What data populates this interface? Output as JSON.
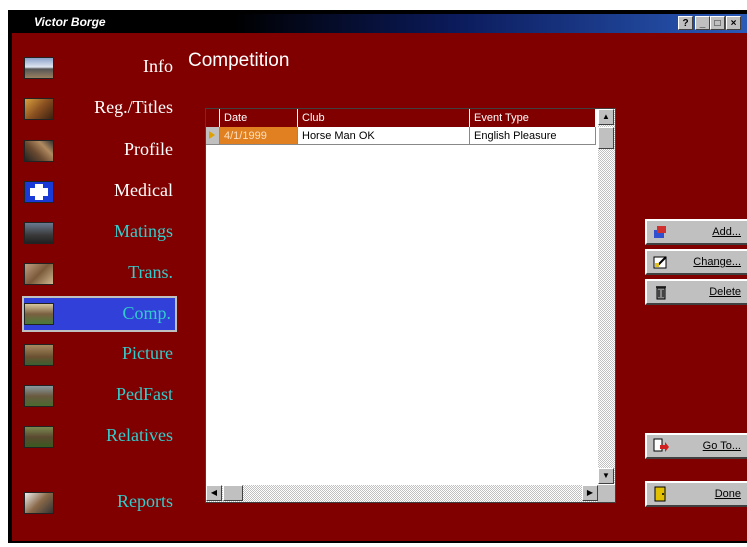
{
  "window": {
    "title": "Victor Borge",
    "controls": [
      "?",
      "_",
      "□",
      "×"
    ]
  },
  "nav": {
    "items": [
      {
        "label": "Info",
        "color": "#ffffff"
      },
      {
        "label": "Reg./Titles",
        "color": "#ffffff"
      },
      {
        "label": "Profile",
        "color": "#ffffff"
      },
      {
        "label": "Medical",
        "color": "#ffffff"
      },
      {
        "label": "Matings",
        "color": "#33cccc"
      },
      {
        "label": "Trans.",
        "color": "#33cccc"
      },
      {
        "label": "Comp.",
        "color": "#33cccc",
        "selected": true
      },
      {
        "label": "Picture",
        "color": "#33cccc"
      },
      {
        "label": "PedFast",
        "color": "#33cccc"
      },
      {
        "label": "Relatives",
        "color": "#33cccc"
      },
      {
        "label": "Reports",
        "color": "#33cccc"
      }
    ]
  },
  "page": {
    "title": "Competition"
  },
  "table": {
    "columns": [
      "Date",
      "Club",
      "Event Type"
    ],
    "rows": [
      {
        "date": "4/1/1999",
        "club": "Horse Man OK",
        "event_type": "English Pleasure"
      }
    ]
  },
  "actions": {
    "add": "Add...",
    "change": "Change...",
    "delete": "Delete",
    "goto": "Go To...",
    "done": "Done"
  },
  "colors": {
    "background": "#800000",
    "selected_cell": "#e08020",
    "selected_nav": "#3040d8",
    "accent_text": "#33cccc"
  }
}
